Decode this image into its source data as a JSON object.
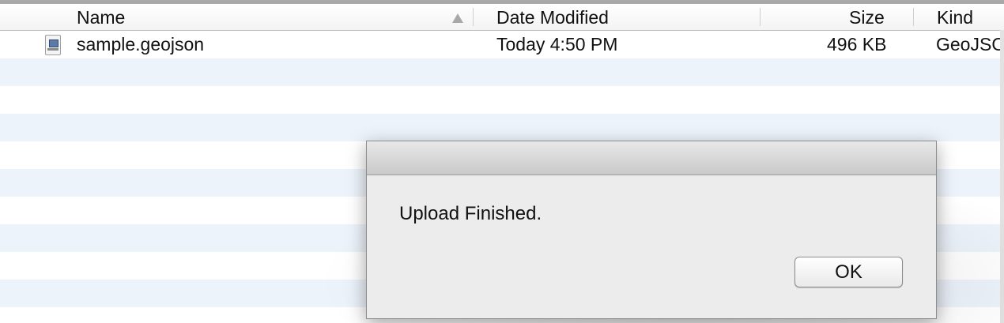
{
  "columns": {
    "name": "Name",
    "date_modified": "Date Modified",
    "size": "Size",
    "kind": "Kind"
  },
  "files": [
    {
      "name": "sample.geojson",
      "date_modified": "Today 4:50 PM",
      "size": "496 KB",
      "kind": "GeoJSO",
      "icon": "geojson-file-icon"
    }
  ],
  "dialog": {
    "message": "Upload Finished.",
    "ok_label": "OK"
  },
  "colors": {
    "alt_row": "#edf3fb",
    "dialog_bg": "#ececec"
  }
}
